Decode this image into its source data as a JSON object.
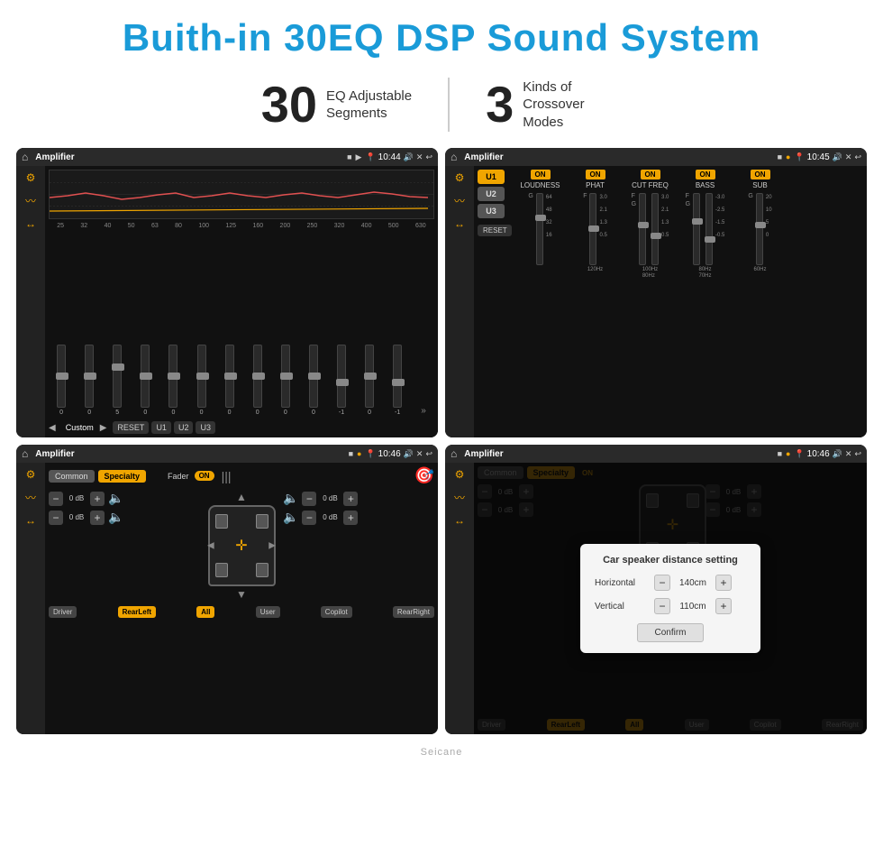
{
  "page": {
    "title": "Buith-in 30EQ DSP Sound System",
    "stats": [
      {
        "number": "30",
        "label": "EQ Adjustable\nSegments"
      },
      {
        "number": "3",
        "label": "Kinds of\nCrossover Modes"
      }
    ]
  },
  "screens": {
    "eq": {
      "title": "Amplifier",
      "time": "10:44",
      "freq_labels": [
        "25",
        "32",
        "40",
        "50",
        "63",
        "80",
        "100",
        "125",
        "160",
        "200",
        "250",
        "320",
        "400",
        "500",
        "630"
      ],
      "sliders": [
        0,
        0,
        5,
        0,
        0,
        0,
        0,
        0,
        0,
        0,
        -1,
        0,
        -1
      ],
      "buttons": [
        "RESET",
        "U1",
        "U2",
        "U3"
      ],
      "custom_label": "Custom"
    },
    "crossover": {
      "title": "Amplifier",
      "time": "10:45",
      "u_buttons": [
        "U1",
        "U2",
        "U3"
      ],
      "columns": [
        {
          "on": true,
          "label": "LOUDNESS"
        },
        {
          "on": true,
          "label": "PHAT"
        },
        {
          "on": true,
          "label": "CUT FREQ"
        },
        {
          "on": true,
          "label": "BASS"
        },
        {
          "on": true,
          "label": "SUB"
        }
      ],
      "reset_label": "RESET"
    },
    "fader": {
      "title": "Amplifier",
      "time": "10:46",
      "common_label": "Common",
      "specialty_label": "Specialty",
      "fader_label": "Fader",
      "on_label": "ON",
      "channels": [
        {
          "label": "0 dB"
        },
        {
          "label": "0 dB"
        },
        {
          "label": "0 dB"
        },
        {
          "label": "0 dB"
        }
      ],
      "zone_buttons": [
        "Driver",
        "RearLeft",
        "All",
        "User",
        "Copilot",
        "RearRight"
      ]
    },
    "distance": {
      "title": "Amplifier",
      "time": "10:46",
      "common_label": "Common",
      "specialty_label": "Specialty",
      "dialog": {
        "title": "Car speaker distance setting",
        "horizontal_label": "Horizontal",
        "horizontal_value": "140cm",
        "vertical_label": "Vertical",
        "vertical_value": "110cm",
        "confirm_label": "Confirm",
        "right_channels": [
          {
            "label": "0 dB"
          },
          {
            "label": "0 dB"
          }
        ]
      }
    }
  },
  "watermark": "Seicane"
}
